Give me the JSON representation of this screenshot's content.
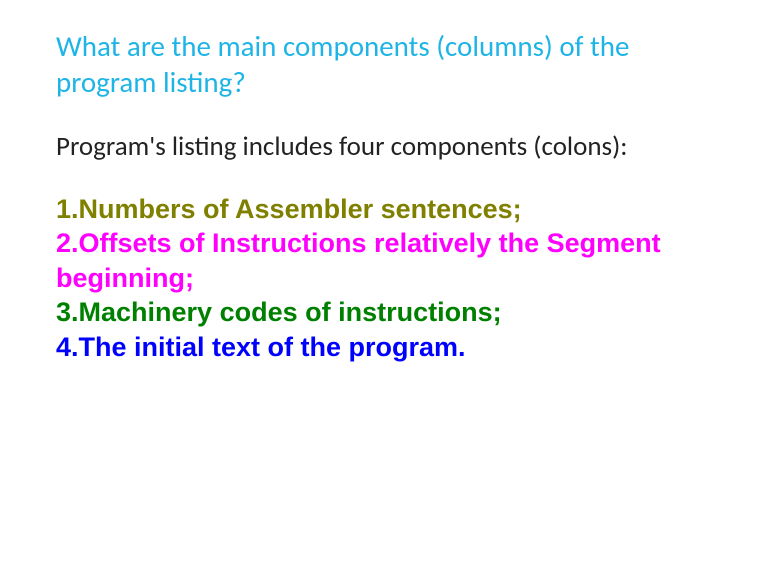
{
  "title": "What are the main components (columns) of the program listing?",
  "intro": "Program's listing includes four components (colons):",
  "items": {
    "i1": "1.Numbers of Assembler sentences;",
    "i2": "2.Offsets of Instructions relatively the Segment beginning;",
    "i3": "3.Machinery codes of instructions;",
    "i4": "4.The initial text of the program."
  }
}
